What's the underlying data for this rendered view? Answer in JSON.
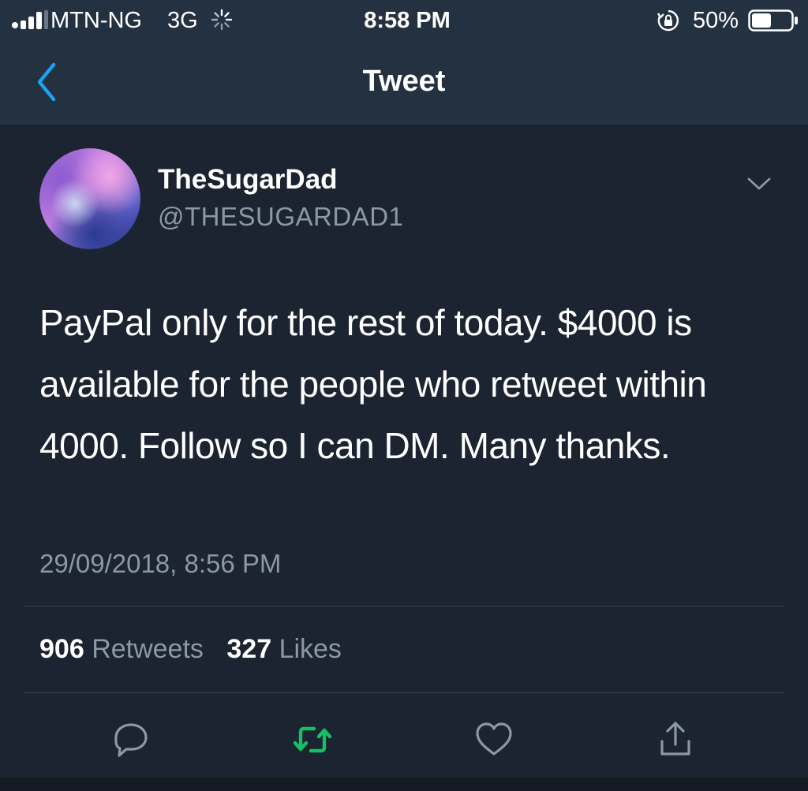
{
  "colors": {
    "background": "#1b2430",
    "header": "#243141",
    "accent_blue": "#1da1f2",
    "retweet_green": "#17bf63",
    "muted_text": "#8b98a5",
    "divider": "#38444d"
  },
  "status_bar": {
    "carrier": "MTN-NG",
    "network": "3G",
    "time": "8:58 PM",
    "battery_percent": "50%",
    "battery_level": 0.5,
    "icons": [
      "signal-icon",
      "activity-spinner-icon",
      "orientation-lock-icon",
      "battery-icon"
    ]
  },
  "nav": {
    "title": "Tweet",
    "back_icon": "chevron-left-icon"
  },
  "tweet": {
    "display_name": "TheSugarDad",
    "handle": "@THESUGARDAD1",
    "text": "PayPal only for the rest of today. $4000 is available for the people who retweet within 4000. Follow so I can DM. Many thanks.",
    "timestamp": "29/09/2018, 8:56 PM",
    "more_icon": "chevron-down-icon"
  },
  "stats": {
    "retweets_count": "906",
    "retweets_label": "Retweets",
    "likes_count": "327",
    "likes_label": "Likes"
  },
  "actions": [
    {
      "name": "reply",
      "icon": "reply-bubble-icon"
    },
    {
      "name": "retweet",
      "icon": "retweet-icon"
    },
    {
      "name": "like",
      "icon": "heart-icon"
    },
    {
      "name": "share",
      "icon": "share-icon"
    }
  ]
}
